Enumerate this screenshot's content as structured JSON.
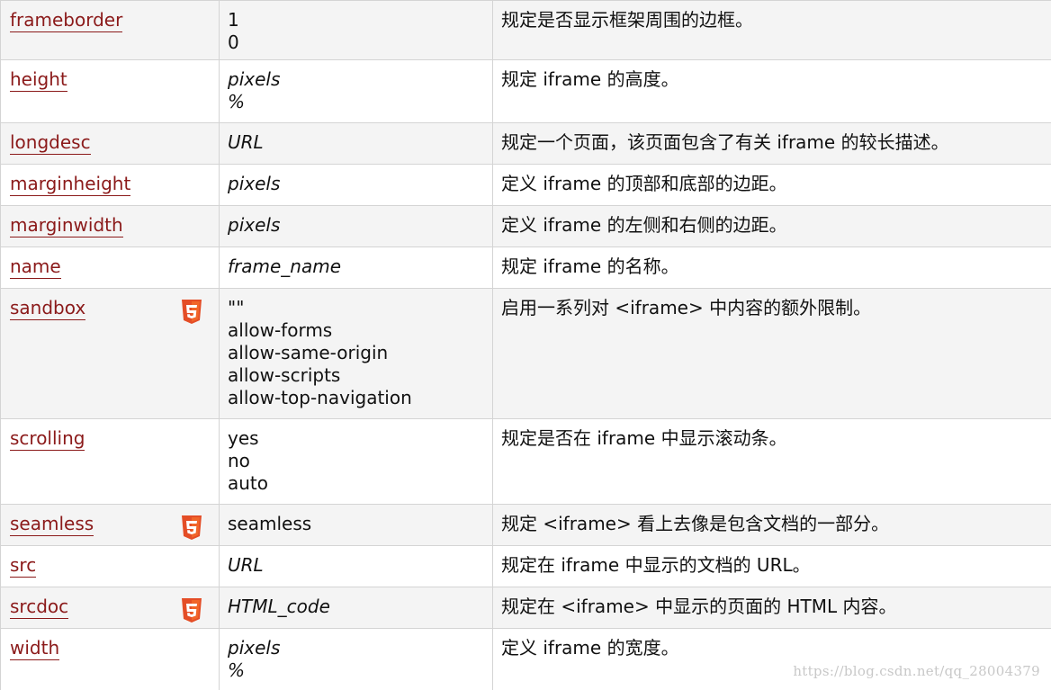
{
  "rows": [
    {
      "name": "frameborder",
      "values": [
        "1",
        "0"
      ],
      "italic": false,
      "html5": false,
      "desc": "规定是否显示框架周围的边框。"
    },
    {
      "name": "height",
      "values": [
        "pixels",
        "%"
      ],
      "italic": true,
      "html5": false,
      "desc": "规定 iframe 的高度。"
    },
    {
      "name": "longdesc",
      "values": [
        "URL"
      ],
      "italic": true,
      "html5": false,
      "desc": "规定一个页面，该页面包含了有关 iframe 的较长描述。"
    },
    {
      "name": "marginheight",
      "values": [
        "pixels"
      ],
      "italic": true,
      "html5": false,
      "desc": "定义 iframe 的顶部和底部的边距。"
    },
    {
      "name": "marginwidth",
      "values": [
        "pixels"
      ],
      "italic": true,
      "html5": false,
      "desc": "定义 iframe 的左侧和右侧的边距。"
    },
    {
      "name": "name",
      "values": [
        "frame_name"
      ],
      "italic": true,
      "html5": false,
      "desc": "规定 iframe 的名称。"
    },
    {
      "name": "sandbox",
      "values": [
        "\"\"",
        "allow-forms",
        "allow-same-origin",
        "allow-scripts",
        "allow-top-navigation"
      ],
      "italic": false,
      "html5": true,
      "desc": "启用一系列对 <iframe> 中内容的额外限制。"
    },
    {
      "name": "scrolling",
      "values": [
        "yes",
        "no",
        "auto"
      ],
      "italic": false,
      "html5": false,
      "desc": "规定是否在 iframe 中显示滚动条。"
    },
    {
      "name": "seamless",
      "values": [
        "seamless"
      ],
      "italic": false,
      "html5": true,
      "desc": "规定 <iframe> 看上去像是包含文档的一部分。"
    },
    {
      "name": "src",
      "values": [
        "URL"
      ],
      "italic": true,
      "html5": false,
      "desc": "规定在 iframe 中显示的文档的 URL。"
    },
    {
      "name": "srcdoc",
      "values": [
        "HTML_code"
      ],
      "italic": true,
      "html5": true,
      "desc": "规定在 <iframe> 中显示的页面的 HTML 内容。"
    },
    {
      "name": "width",
      "values": [
        "pixels",
        "%"
      ],
      "italic": true,
      "html5": false,
      "desc": "定义 iframe 的宽度。"
    }
  ],
  "colors": {
    "link": "#8b1a1a",
    "html5_badge": "#e44d26",
    "row_alt": "#f4f4f4",
    "border": "#d4d4d4"
  },
  "icons": {
    "html5_badge": "html5-shield-icon"
  },
  "watermark": "https://blog.csdn.net/qq_28004379"
}
